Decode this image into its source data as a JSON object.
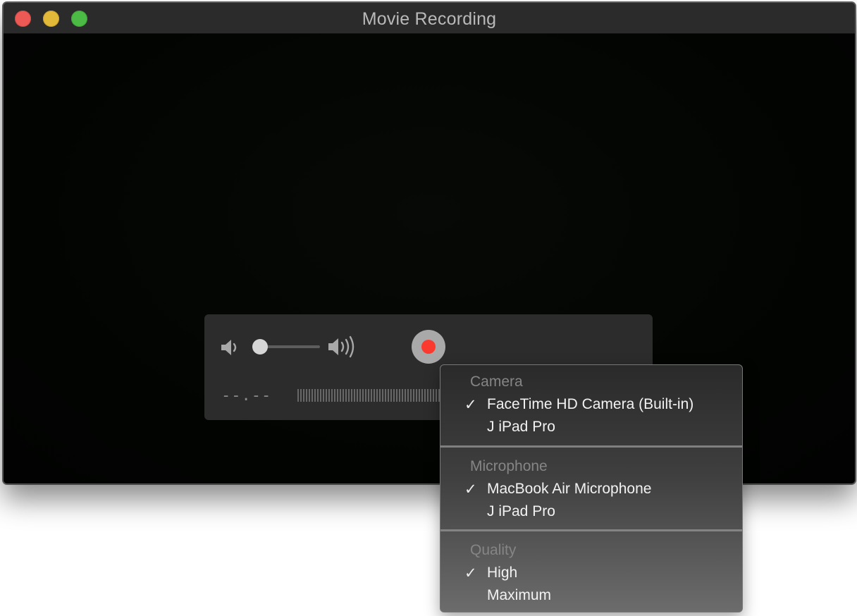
{
  "window": {
    "title": "Movie Recording",
    "buttons": {
      "close": "close",
      "minimize": "minimize",
      "zoom": "zoom"
    }
  },
  "controls": {
    "volume_level": 0.1,
    "elapsed_time": "--.--",
    "record_color": "#fb3a2f"
  },
  "menu": {
    "sections": [
      {
        "header": "Camera",
        "items": [
          {
            "label": "FaceTime HD Camera (Built-in)",
            "checked": true
          },
          {
            "label": "J iPad Pro",
            "checked": false
          }
        ]
      },
      {
        "header": "Microphone",
        "items": [
          {
            "label": "MacBook Air Microphone",
            "checked": true
          },
          {
            "label": "J iPad Pro",
            "checked": false
          }
        ]
      },
      {
        "header": "Quality",
        "items": [
          {
            "label": "High",
            "checked": true
          },
          {
            "label": "Maximum",
            "checked": false
          }
        ]
      }
    ],
    "check_glyph": "✓"
  }
}
